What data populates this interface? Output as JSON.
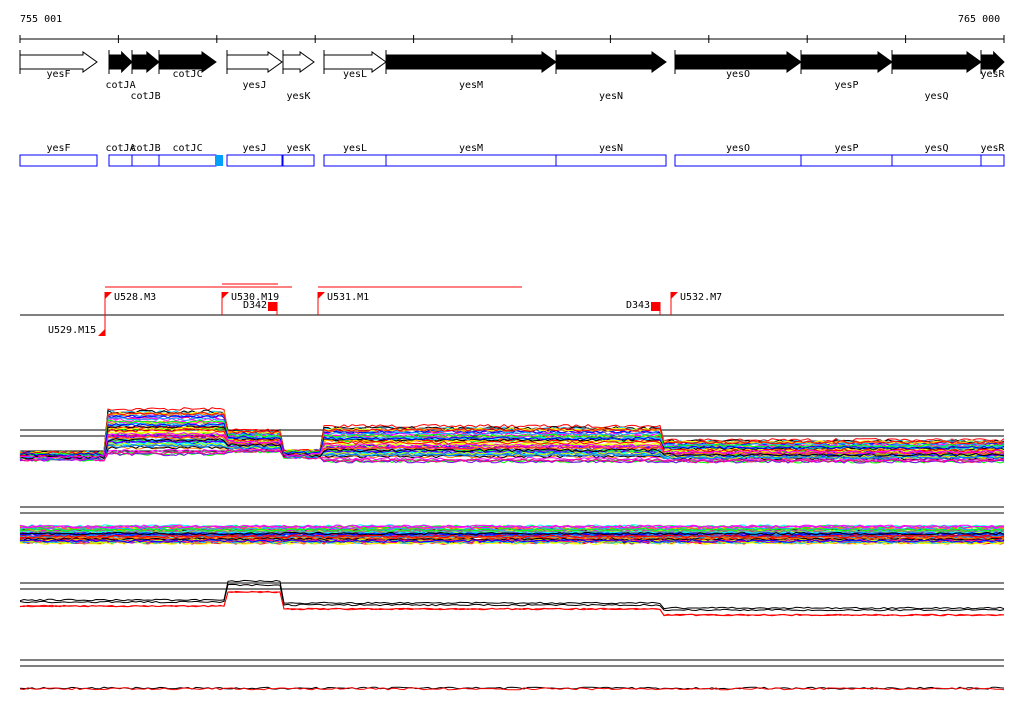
{
  "ruler": {
    "start_label": "755 001",
    "end_label": "765 000"
  },
  "genes": [
    {
      "name": "yesF",
      "strand": "white",
      "start": 20,
      "end": 97,
      "row": 0
    },
    {
      "name": "cotJA",
      "strand": "black",
      "start": 109,
      "end": 132,
      "row": 1
    },
    {
      "name": "cotJB",
      "strand": "black",
      "start": 132,
      "end": 159,
      "row": 2
    },
    {
      "name": "cotJC",
      "strand": "black",
      "start": 159,
      "end": 216,
      "row": 0
    },
    {
      "name": "yesJ",
      "strand": "white",
      "start": 227,
      "end": 282,
      "row": 1
    },
    {
      "name": "yesK",
      "strand": "white",
      "start": 283,
      "end": 314,
      "row": 2
    },
    {
      "name": "yesL",
      "strand": "white",
      "start": 324,
      "end": 386,
      "row": 0
    },
    {
      "name": "yesM",
      "strand": "black",
      "start": 386,
      "end": 556,
      "row": 1
    },
    {
      "name": "yesN",
      "strand": "black",
      "start": 556,
      "end": 666,
      "row": 2
    },
    {
      "name": "yesO",
      "strand": "black",
      "start": 675,
      "end": 801,
      "row": 0
    },
    {
      "name": "yesP",
      "strand": "black",
      "start": 801,
      "end": 892,
      "row": 1
    },
    {
      "name": "yesQ",
      "strand": "black",
      "start": 892,
      "end": 981,
      "row": 2
    },
    {
      "name": "yesR",
      "strand": "black",
      "start": 981,
      "end": 1004,
      "row": 0
    }
  ],
  "promoters": [
    {
      "label": "U528.M3",
      "pos": 105,
      "side": "up"
    },
    {
      "label": "U530.M19",
      "pos": 222,
      "side": "up"
    },
    {
      "label": "U531.M1",
      "pos": 318,
      "side": "up"
    },
    {
      "label": "U532.M7",
      "pos": 671,
      "side": "up"
    },
    {
      "label": "U529.M15",
      "pos": 105,
      "side": "down"
    }
  ],
  "terminators": [
    {
      "label": "D342",
      "pos": 277
    },
    {
      "label": "D343",
      "pos": 660
    }
  ],
  "colors": {
    "gene_box": "#0000ff",
    "highlight": "#00a0ff",
    "promoter": "#ff0000"
  },
  "trace_colors": [
    "#ff0000",
    "#00ff00",
    "#0000ff",
    "#ff00ff",
    "#00ffff",
    "#ffff00",
    "#ff8000",
    "#808080",
    "#8000ff",
    "#00c0ff",
    "#c0ff00",
    "#ff0080",
    "#0080ff",
    "#000000"
  ]
}
